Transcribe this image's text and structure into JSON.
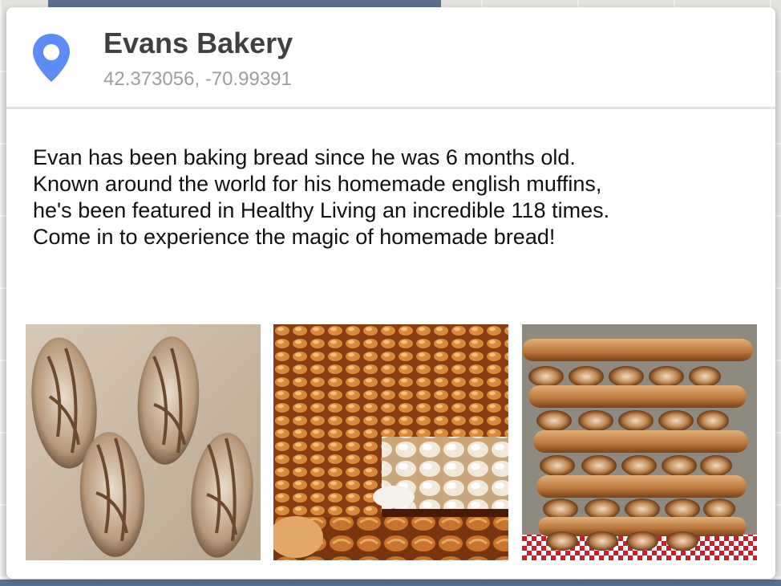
{
  "place": {
    "name": "Evans Bakery",
    "coordinates": "42.373056, -70.99391",
    "icon": "map-pin-icon",
    "accent_color": "#5b8df5"
  },
  "description": {
    "lines": [
      "Evan has been baking bread since he was 6 months old.",
      "Known around the world for his homemade english muffins,",
      "he's been featured in Healthy Living an incredible 118 times.",
      "Come in to experience the magic of homemade bread!"
    ]
  },
  "photos": [
    {
      "subject": "sourdough loaves"
    },
    {
      "subject": "pastry display"
    },
    {
      "subject": "stacked baguettes"
    }
  ]
}
